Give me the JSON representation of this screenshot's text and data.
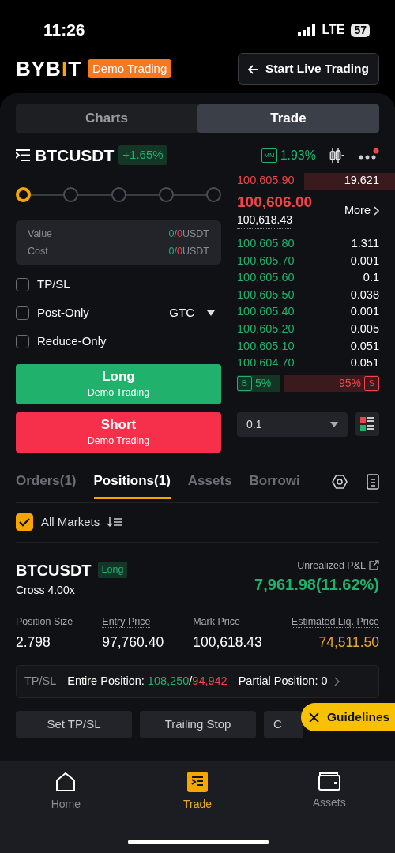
{
  "status_bar": {
    "time": "11:26",
    "network": "LTE",
    "battery": "57"
  },
  "header": {
    "logo": "BYBIT",
    "mode_badge": "Demo Trading",
    "live_button": "Start Live Trading"
  },
  "view_tabs": [
    {
      "label": "Charts",
      "selected": false
    },
    {
      "label": "Trade",
      "selected": true
    }
  ],
  "symbol": {
    "name": "BTCUSDT",
    "change": "+1.65%",
    "mm_label": "MM",
    "mm_value": "1.93%",
    "notification": true
  },
  "order_form": {
    "leverage_steps": [
      {
        "selected": true
      },
      {
        "selected": false
      },
      {
        "selected": false
      },
      {
        "selected": false
      },
      {
        "selected": false
      }
    ],
    "summary": [
      {
        "label": "Value",
        "buy": "0",
        "sep": "/",
        "sell": "0",
        "unit": "USDT"
      },
      {
        "label": "Cost",
        "buy": "0",
        "sep": "/",
        "sell": "0",
        "unit": "USDT"
      }
    ],
    "options": [
      {
        "label": "TP/SL",
        "checked": false
      },
      {
        "label": "Post-Only",
        "checked": false,
        "select": "GTC"
      },
      {
        "label": "Reduce-Only",
        "checked": false
      }
    ],
    "buttons": [
      {
        "kind": "long",
        "label": "Long",
        "sub": "Demo Trading"
      },
      {
        "kind": "short",
        "label": "Short",
        "sub": "Demo Trading"
      }
    ]
  },
  "order_book": {
    "asks": [
      {
        "price": "100,605.90",
        "qty": "19.621"
      }
    ],
    "last_price": "100,606.00",
    "mark_price": "100,618.43",
    "more": "More",
    "bids": [
      {
        "price": "100,605.80",
        "qty": "1.311"
      },
      {
        "price": "100,605.70",
        "qty": "0.001"
      },
      {
        "price": "100,605.60",
        "qty": "0.1"
      },
      {
        "price": "100,605.50",
        "qty": "0.038"
      },
      {
        "price": "100,605.40",
        "qty": "0.001"
      },
      {
        "price": "100,605.20",
        "qty": "0.005"
      },
      {
        "price": "100,605.10",
        "qty": "0.051"
      },
      {
        "price": "100,604.70",
        "qty": "0.051"
      }
    ],
    "ratio": {
      "buy_label": "B",
      "buy": "5%",
      "sell": "95%",
      "sell_label": "S"
    },
    "precision": "0.1"
  },
  "bottom_tabs": [
    {
      "label": "Orders(1)",
      "selected": false
    },
    {
      "label": "Positions(1)",
      "selected": true
    },
    {
      "label": "Assets",
      "selected": false
    },
    {
      "label": "Borrowi",
      "selected": false
    }
  ],
  "filter": {
    "label": "All Markets",
    "checked": true
  },
  "position": {
    "symbol": "BTCUSDT",
    "side": "Long",
    "margin": "Cross 4.00x",
    "pnl_label": "Unrealized P&L",
    "pnl": "7,961.98(11.62%)",
    "stats": [
      {
        "label": "Position Size",
        "value": "2.798",
        "kind": "plain"
      },
      {
        "label": "Entry Price",
        "value": "97,760.40",
        "kind": "dotted"
      },
      {
        "label": "Mark Price",
        "value": "100,618.43",
        "kind": "plain"
      },
      {
        "label": "Estimated Liq. Price",
        "value": "74,511.50",
        "kind": "warn"
      }
    ],
    "tpsl": {
      "label": "TP/SL",
      "entire_label": "Entire Position:",
      "tp": "108,250",
      "sep": "/",
      "sl": "94,942",
      "partial": "Partial Position: 0"
    },
    "actions": [
      "Set TP/SL",
      "Trailing Stop",
      "C"
    ]
  },
  "guidelines": "Guidelines",
  "nav": [
    {
      "label": "Home",
      "selected": false,
      "kind": "home"
    },
    {
      "label": "Trade",
      "selected": true,
      "kind": "trade"
    },
    {
      "label": "Assets",
      "selected": false,
      "kind": "assets"
    }
  ]
}
